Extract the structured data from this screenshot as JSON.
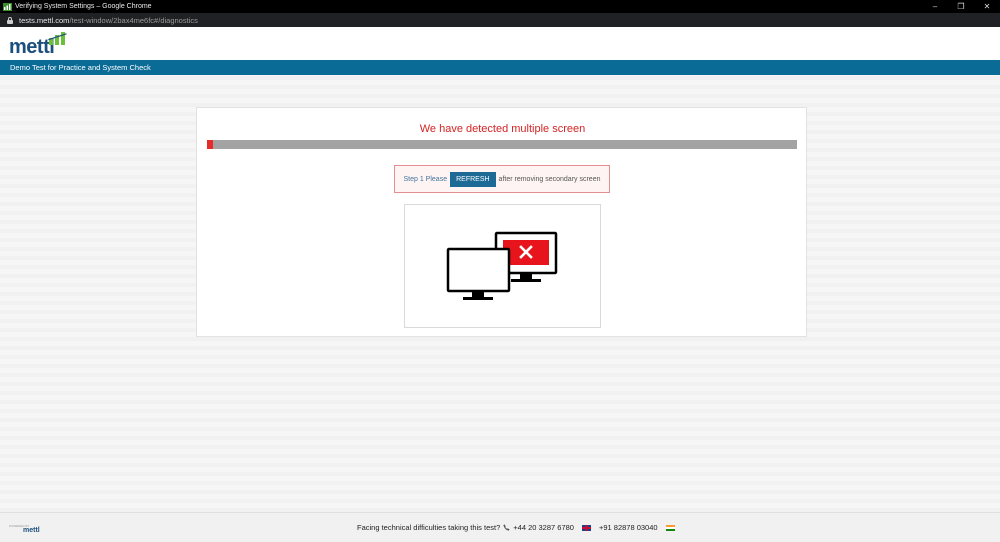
{
  "browser": {
    "window_title": "Verifying System Settings – Google Chrome",
    "url_host": "tests.mettl.com",
    "url_path": "/test-window/2bax4me6fc#/diagnostics",
    "controls": [
      "–",
      "❐",
      "✕"
    ]
  },
  "site": {
    "logo_text": "mettl",
    "subheader": "Demo Test for Practice and System Check"
  },
  "card": {
    "title": "We have detected multiple screen",
    "progress_fraction": 0.01,
    "step": {
      "label": "Step 1 Please",
      "button": "REFRESH",
      "suffix": "after removing secondary screen"
    }
  },
  "footer": {
    "powered_by": "POWERED BY",
    "brand": "mettl",
    "text": "Facing technical difficulties taking this test?",
    "phone_uk": "+44 20 3287 6780",
    "phone_in": "+91 82878 03040"
  },
  "colors": {
    "accent": "#0a6b96",
    "error": "#d32424",
    "progress_track": "#a3a3a3"
  },
  "icons": [
    "lock-icon",
    "phone-icon",
    "uk-flag-icon",
    "india-flag-icon",
    "monitor-icon",
    "error-monitor-icon",
    "close-x-icon"
  ]
}
